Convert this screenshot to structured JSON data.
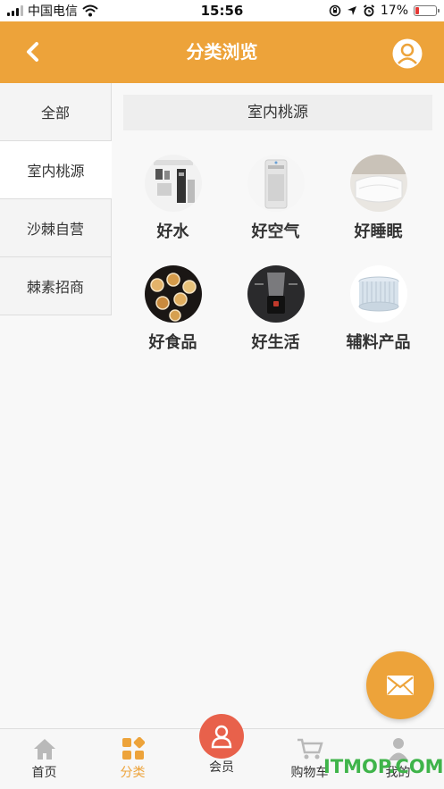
{
  "status_bar": {
    "carrier": "中国电信",
    "time": "15:56",
    "battery_percent": "17%",
    "battery_level": 0.17
  },
  "header": {
    "title": "分类浏览"
  },
  "sidebar": {
    "items": [
      {
        "label": "全部"
      },
      {
        "label": "室内桃源"
      },
      {
        "label": "沙棘自营"
      },
      {
        "label": "棘素招商"
      }
    ],
    "active_index": 1
  },
  "content": {
    "section_title": "室内桃源",
    "categories": [
      {
        "label": "好水",
        "icon": "water-purifier-thumb"
      },
      {
        "label": "好空气",
        "icon": "air-purifier-thumb"
      },
      {
        "label": "好睡眠",
        "icon": "pillow-thumb"
      },
      {
        "label": "好食品",
        "icon": "food-bowls-thumb"
      },
      {
        "label": "好生活",
        "icon": "blender-thumb"
      },
      {
        "label": "辅料产品",
        "icon": "filter-thumb"
      }
    ]
  },
  "tabbar": {
    "tabs": [
      {
        "label": "首页",
        "icon": "home-icon"
      },
      {
        "label": "分类",
        "icon": "category-icon"
      },
      {
        "label": "会员",
        "icon": "member-icon"
      },
      {
        "label": "购物车",
        "icon": "cart-icon"
      },
      {
        "label": "我的",
        "icon": "user-icon"
      }
    ],
    "active_index": 1
  },
  "watermark": "ITMOP.COM",
  "colors": {
    "accent": "#eda33a",
    "member": "#e8614b",
    "watermark": "#3fb44a"
  }
}
